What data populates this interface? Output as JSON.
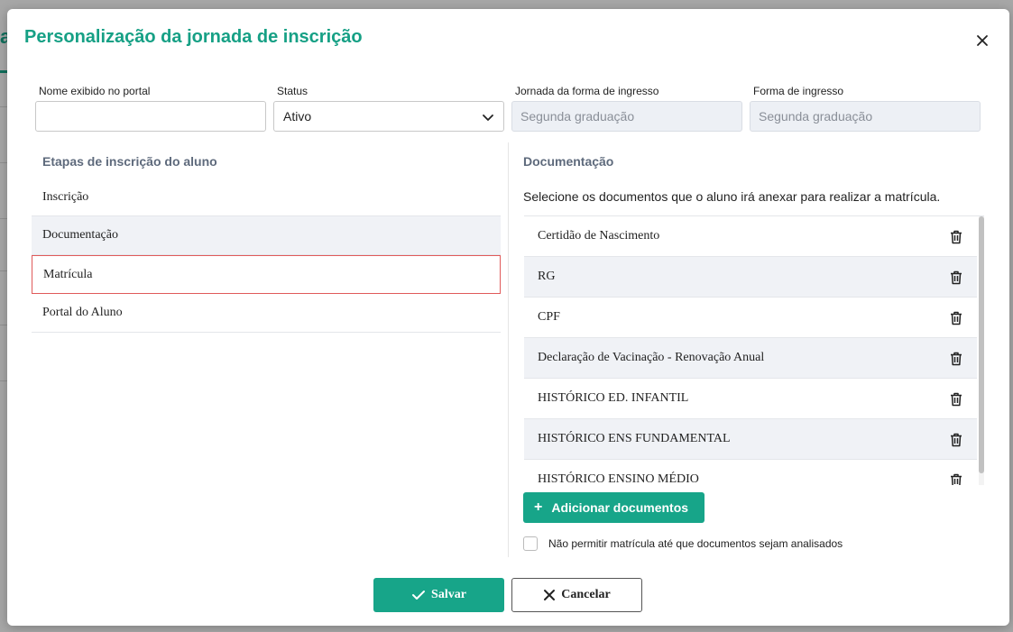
{
  "modal": {
    "title": "Personalização da jornada de inscrição"
  },
  "background": {
    "letter": "a"
  },
  "fields": {
    "portal_name": {
      "label": "Nome exibido no portal",
      "value": "",
      "placeholder": ""
    },
    "status": {
      "label": "Status",
      "value": "Ativo"
    },
    "journey": {
      "label": "Jornada da forma de ingresso",
      "value": "Segunda graduação"
    },
    "admission": {
      "label": "Forma de ingresso",
      "value": "Segunda graduação"
    }
  },
  "steps": {
    "heading": "Etapas de inscrição do aluno",
    "items": [
      {
        "label": "Inscrição"
      },
      {
        "label": "Documentação"
      },
      {
        "label": "Matrícula"
      },
      {
        "label": "Portal do Aluno"
      }
    ]
  },
  "documentation": {
    "heading": "Documentação",
    "description": "Selecione os documentos que o aluno irá anexar para realizar a matrícula.",
    "documents": [
      {
        "label": "Certidão de Nascimento"
      },
      {
        "label": "RG"
      },
      {
        "label": "CPF"
      },
      {
        "label": "Declaração de Vacinação - Renovação Anual"
      },
      {
        "label": "HISTÓRICO ED. INFANTIL"
      },
      {
        "label": "HISTÓRICO ENS FUNDAMENTAL"
      },
      {
        "label": "HISTÓRICO ENSINO MÉDIO"
      }
    ],
    "add_label": "Adicionar documentos",
    "checkbox_label": "Não permitir matrícula até que documentos sejam analisados",
    "checkbox_checked": false
  },
  "footer": {
    "save_label": "Salvar",
    "cancel_label": "Cancelar"
  },
  "colors": {
    "accent": "#16a085",
    "selected_border": "#e05a5a",
    "heading": "#5e6a7c"
  }
}
